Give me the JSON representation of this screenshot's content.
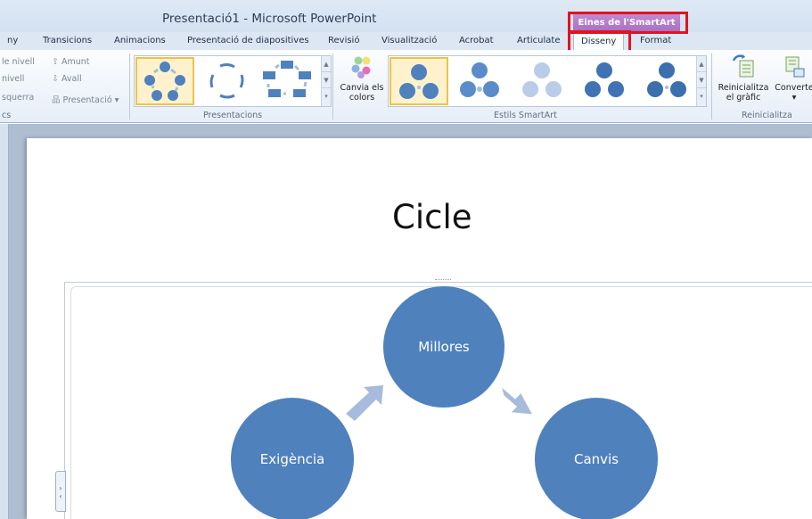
{
  "window": {
    "title": "Presentació1 - Microsoft PowerPoint",
    "context_tab": "Eines de l'SmartArt"
  },
  "tabs": [
    "ny",
    "Transicions",
    "Animacions",
    "Presentació de diapositives",
    "Revisió",
    "Visualització",
    "Acrobat",
    "Articulate",
    "Disseny",
    "Format"
  ],
  "active_tab": "Disseny",
  "ribbon": {
    "create_graphic": {
      "items": [
        "le nivell",
        "nivell",
        "squerra",
        "Amunt",
        "Avall",
        "Presentació"
      ],
      "label": "cs"
    },
    "layouts": {
      "label": "Presentacions"
    },
    "styles": {
      "change_colors_label": "Canvia els colors",
      "label": "Estils SmartArt"
    },
    "reset": {
      "reset_label": "Reinicialitza el gràfic",
      "convert_label": "Converte",
      "label": "Reinicialitza"
    }
  },
  "slide": {
    "title": "Cicle",
    "nodes": [
      "Millores",
      "Canvis",
      "Exigència"
    ]
  },
  "colors": {
    "node_fill": "#4f81bd",
    "arrow_fill": "#a7bcdc",
    "context_tab": "#b07ac6",
    "highlight": "#e0141e"
  }
}
